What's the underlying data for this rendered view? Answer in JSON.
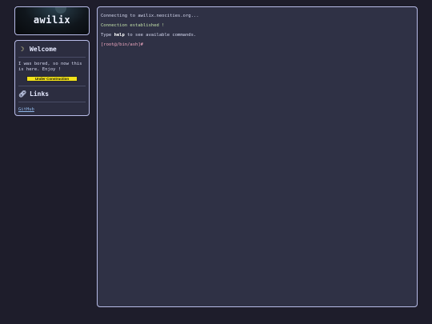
{
  "sidebar": {
    "logo_title": "awilix",
    "welcome_panel": {
      "icon": "moon-icon",
      "title": "Welcome",
      "text": "I was bored, so now this is here. Enjoy !",
      "badge": "Under Construction"
    },
    "links_panel": {
      "icon": "link-icon",
      "title": "Links",
      "items": [
        {
          "label": "GitHub"
        }
      ]
    }
  },
  "terminal": {
    "line1": "Connecting to awilix.neocities.org...",
    "line2": "Connection established !",
    "line3": {
      "prefix": "Type ",
      "keyword": "help",
      "suffix": " to see available commands."
    },
    "prompt": "[root@/bin/ash]#"
  },
  "colors": {
    "background": "#1e1d2b",
    "panel": "#2c2d40",
    "border": "#b8bce8",
    "success_text": "#c2e0a8",
    "prompt_text": "#f0a8c0",
    "badge": "#f2e21a"
  }
}
